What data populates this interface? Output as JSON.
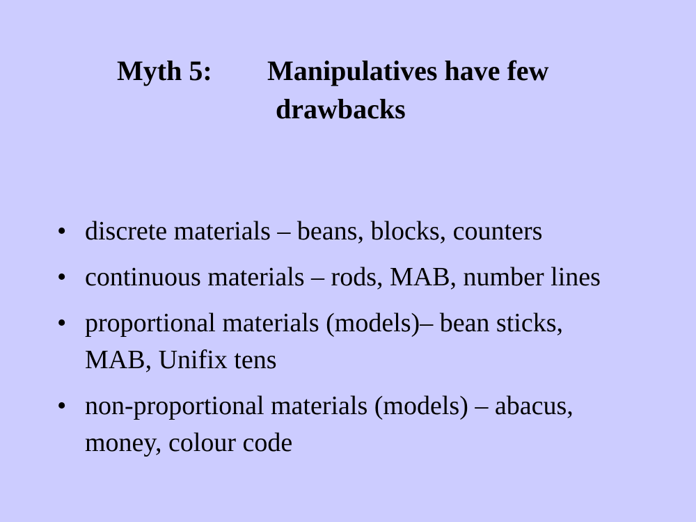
{
  "slide": {
    "background": "#ccccff",
    "title": {
      "prefix": "Myth 5:",
      "line1": "Manipulatives have few",
      "line2": "drawbacks"
    },
    "bullet_symbol": "•",
    "bullets": [
      "discrete materials – beans, blocks, counters",
      "continuous materials – rods, MAB, number lines",
      "proportional materials (models)– bean sticks, MAB, Unifix tens",
      "non-proportional materials (models) – abacus, money, colour code"
    ]
  }
}
